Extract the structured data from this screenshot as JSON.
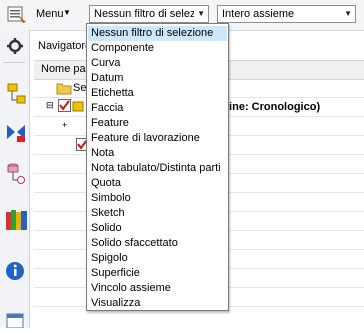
{
  "toolbar": {
    "menu_label": "Menu",
    "selection_filter": "Nessun filtro di selezione",
    "assembly_scope": "Intero assieme"
  },
  "navigator": {
    "title": "Navigatore",
    "column_header": "Nome par",
    "root_item": "Se",
    "history_suffix": "line: Cronologico)"
  },
  "filter_options": [
    "Nessun filtro di selezione",
    "Componente",
    "Curva",
    "Datum",
    "Etichetta",
    "Faccia",
    "Feature",
    "Feature di lavorazione",
    "Nota",
    "Nota tabulato/Distinta parti",
    "Quota",
    "Simbolo",
    "Sketch",
    "Solido",
    "Solido sfaccettato",
    "Spigolo",
    "Superficie",
    "Vincolo assieme",
    "Visualizza"
  ],
  "selected_option": "Nessun filtro di selezione",
  "left_toolbar_icons": [
    "settings-icon",
    "assembly-navigator-icon",
    "constraint-navigator-icon",
    "part-navigator-icon",
    "reuse-library-icon",
    "history-icon",
    "info-icon",
    "web-browser-icon"
  ],
  "colors": {
    "selection_highlight": "#cce8ff",
    "toolbar_bg": "#f4f5f7"
  }
}
